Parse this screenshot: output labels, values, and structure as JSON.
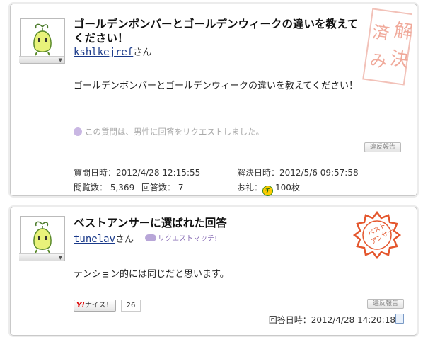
{
  "question": {
    "title": "ゴールデンボンバーとゴールデンウィークの違いを教えてください！",
    "username": "kshlkejref",
    "san": "さん",
    "body": "ゴールデンボンバーとゴールデンウィークの違いを教えてください！",
    "request_note": "この質問は、男性に回答をリクエストしました。",
    "report_label": "違反報告",
    "stamp_text": "解決済み",
    "asked_label": "質問日時：",
    "asked_value": "2012/4/28 12:15:55",
    "solved_label": "解決日時：",
    "solved_value": "2012/5/6 09:57:58",
    "views_label": "閲覧数：",
    "views_value": "5,369",
    "answers_label": "回答数：",
    "answers_value": "7",
    "reward_label": "お礼：",
    "reward_coin": "チ",
    "reward_value": "100枚"
  },
  "best_answer": {
    "title": "ベストアンサーに選ばれた回答",
    "username": "tunelav",
    "san": "さん",
    "match_badge": "リクエストマッチ!",
    "body": "テンション的には同じだと思います。",
    "nice_label": "ナイス！",
    "nice_y": "Y!",
    "nice_count": "26",
    "report_label": "違反報告",
    "answered_label": "回答日時：",
    "answered_value": "2012/4/28 14:20:18",
    "stamp_text": "ベストアンサー"
  },
  "icons": {
    "avatar": "sprout-character-avatar",
    "request": "people-request-icon",
    "coin": "chiebukuro-coin-icon",
    "doc": "document-icon"
  },
  "colors": {
    "stamp_red": "#e4572e",
    "link_blue": "#1a3a8a",
    "muted": "#aaaaaa"
  }
}
